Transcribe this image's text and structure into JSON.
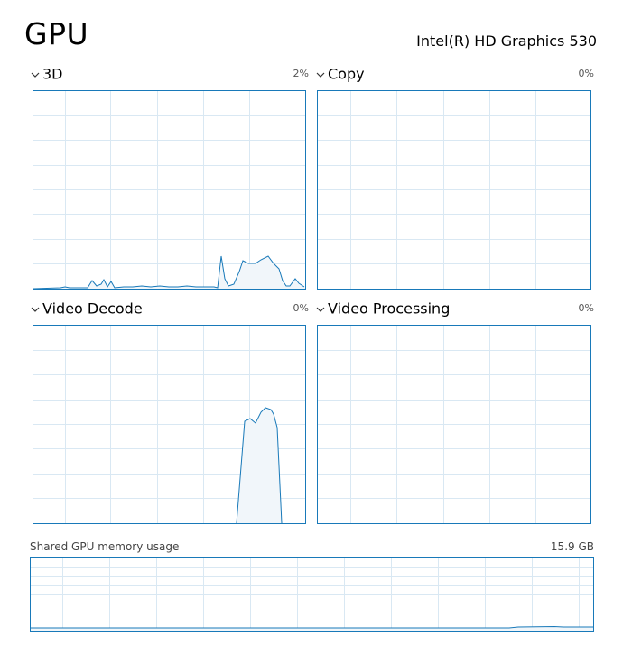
{
  "header": {
    "title": "GPU",
    "adapter_name": "Intel(R) HD Graphics 530"
  },
  "engines": [
    {
      "label": "3D",
      "percent": "2%",
      "icon": "chevron-down-icon"
    },
    {
      "label": "Copy",
      "percent": "0%",
      "icon": "chevron-down-icon"
    },
    {
      "label": "Video Decode",
      "percent": "0%",
      "icon": "chevron-down-icon"
    },
    {
      "label": "Video Processing",
      "percent": "0%",
      "icon": "chevron-down-icon"
    }
  ],
  "shared_memory": {
    "label": "Shared GPU memory usage",
    "value": "15.9 GB"
  },
  "colors": {
    "line": "#1879b9",
    "fill": "#f1f6fa",
    "grid": "#d9e8f3"
  }
}
